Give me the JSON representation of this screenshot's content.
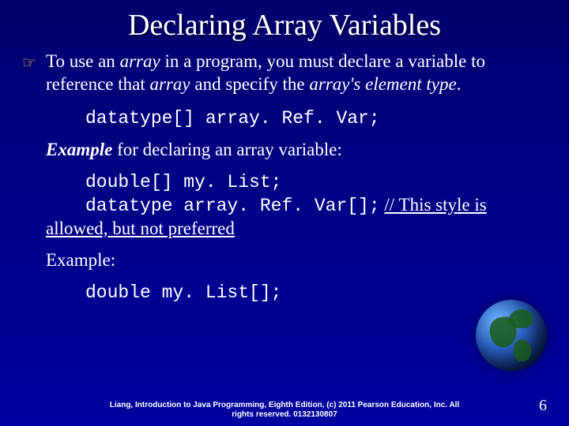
{
  "title": "Declaring Array Variables",
  "bullet_marker": "☞",
  "bullet": {
    "pre": "To use an ",
    "em1": "array",
    "mid1": " in a program, you must declare a variable to reference that ",
    "em2": "array",
    "mid2": " and specify the ",
    "em3": "array's element type",
    "post": "."
  },
  "code1": "datatype[] array. Ref. Var;",
  "example_intro": {
    "strong": "Example",
    "rest": " for declaring an array variable:"
  },
  "code2": "double[] my. List;",
  "code3_code": "datatype array. Ref. Var[];",
  "code3_note_part1": " // This style is",
  "code3_note_part2": "allowed, but not preferred",
  "example_label": "Example:",
  "code4": "double my. List[];",
  "footer_line1": "Liang, Introduction to Java Programming, Eighth Edition, (c) 2011 Pearson Education, Inc. All",
  "footer_line2": "rights reserved. 0132130807",
  "page_number": "6"
}
